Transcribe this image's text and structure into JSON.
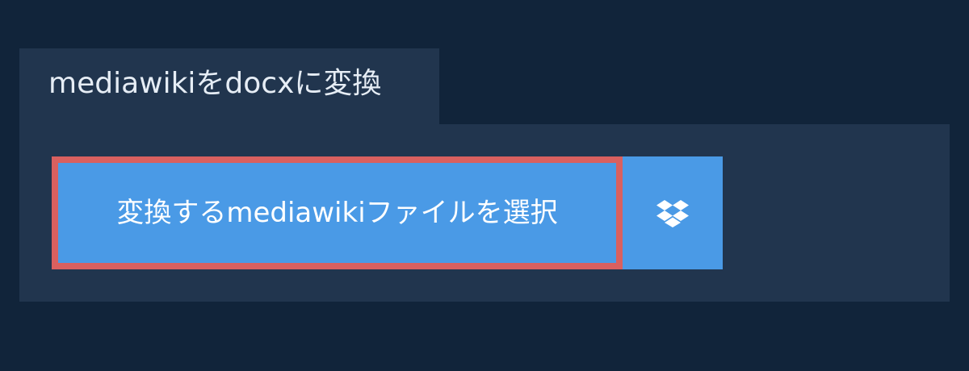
{
  "header": {
    "title": "mediawikiをdocxに変換"
  },
  "upload": {
    "select_label": "変換するmediawikiファイルを選択",
    "dropbox_icon": "dropbox-icon"
  },
  "colors": {
    "page_background": "#11243a",
    "panel_background": "#21354e",
    "button_background": "#4a9ae6",
    "focus_border": "#d9605f",
    "text": "#ffffff"
  }
}
